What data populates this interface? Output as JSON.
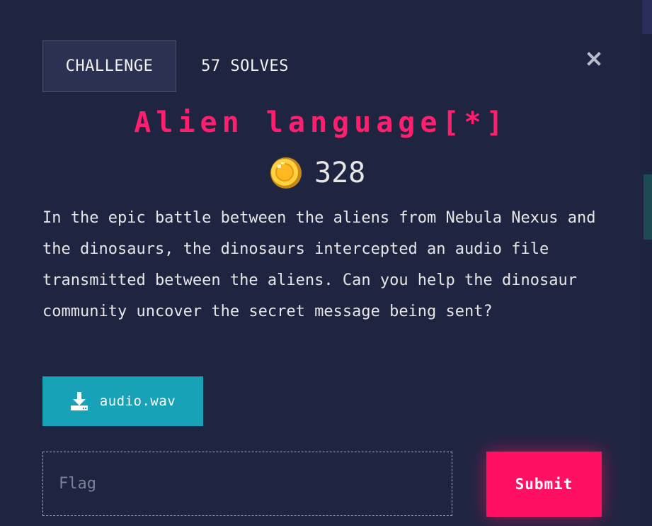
{
  "tabs": {
    "challenge_label": "CHALLENGE",
    "solves_label": "57 SOLVES"
  },
  "challenge": {
    "title": "Alien language[*]",
    "points": "328",
    "description": "In the epic battle between the aliens from Nebula Nexus and the dinosaurs, the dinosaurs intercepted an audio file transmitted between the aliens. Can you help the dinosaur community uncover the secret message being sent?"
  },
  "attachment": {
    "filename": "audio.wav"
  },
  "flag_form": {
    "placeholder": "Flag",
    "value": "",
    "submit_label": "Submit"
  },
  "icons": {
    "close": "close-icon",
    "coin": "coin-icon",
    "download": "download-icon"
  },
  "colors": {
    "title": "#ff1f6e",
    "submit": "#ff1063",
    "download_button": "#17a2b8",
    "background": "#1f2541"
  }
}
